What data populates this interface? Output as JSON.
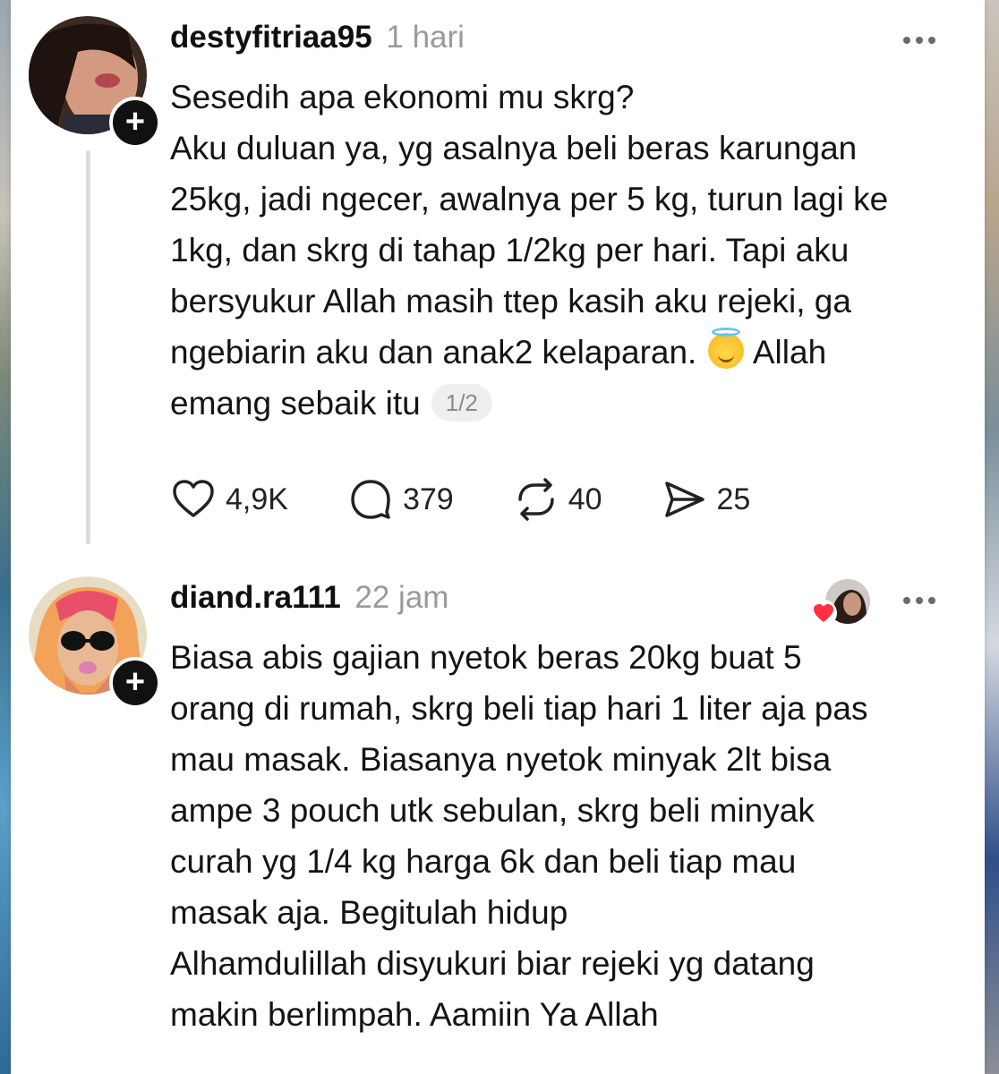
{
  "posts": [
    {
      "username": "destyfitriaa95",
      "time": "1 hari",
      "lines": [
        "Sesedih apa ekonomi mu skrg?",
        "Aku duluan ya, yg asalnya beli beras karungan",
        "25kg, jadi ngecer, awalnya per 5 kg, turun lagi ke",
        "1kg, dan skrg di tahap 1/2kg per hari. Tapi aku",
        "bersyukur Allah masih ttep kasih aku rejeki, ga",
        "ngebiarin aku dan anak2 kelaparan.",
        "Allah",
        "emang sebaik itu"
      ],
      "page_indicator": "1/2",
      "stats": {
        "likes": "4,9K",
        "replies": "379",
        "reposts": "40",
        "shares": "25"
      }
    },
    {
      "username": "diand.ra111",
      "time": "22 jam",
      "lines": [
        "Biasa abis gajian nyetok beras 20kg buat 5",
        "orang di rumah, skrg beli tiap hari 1 liter aja pas",
        "mau masak. Biasanya nyetok minyak 2lt bisa",
        "ampe 3 pouch utk sebulan, skrg beli minyak",
        "curah yg 1/4 kg harga 6k dan beli tiap mau",
        "masak aja. Begitulah hidup",
        "Alhamdulillah disyukuri biar rejeki yg datang",
        "makin berlimpah. Aamiin Ya Allah"
      ]
    }
  ],
  "follow_badge": "+",
  "icons": {
    "like": "heart-icon",
    "reply": "comment-bubble-icon",
    "repost": "repost-icon",
    "share": "send-icon",
    "more": "more-dots-icon",
    "emoji": "smiling-face-with-halo"
  },
  "colors": {
    "text": "#141414",
    "muted": "#9a9a9a",
    "heart": "#ff3040"
  }
}
